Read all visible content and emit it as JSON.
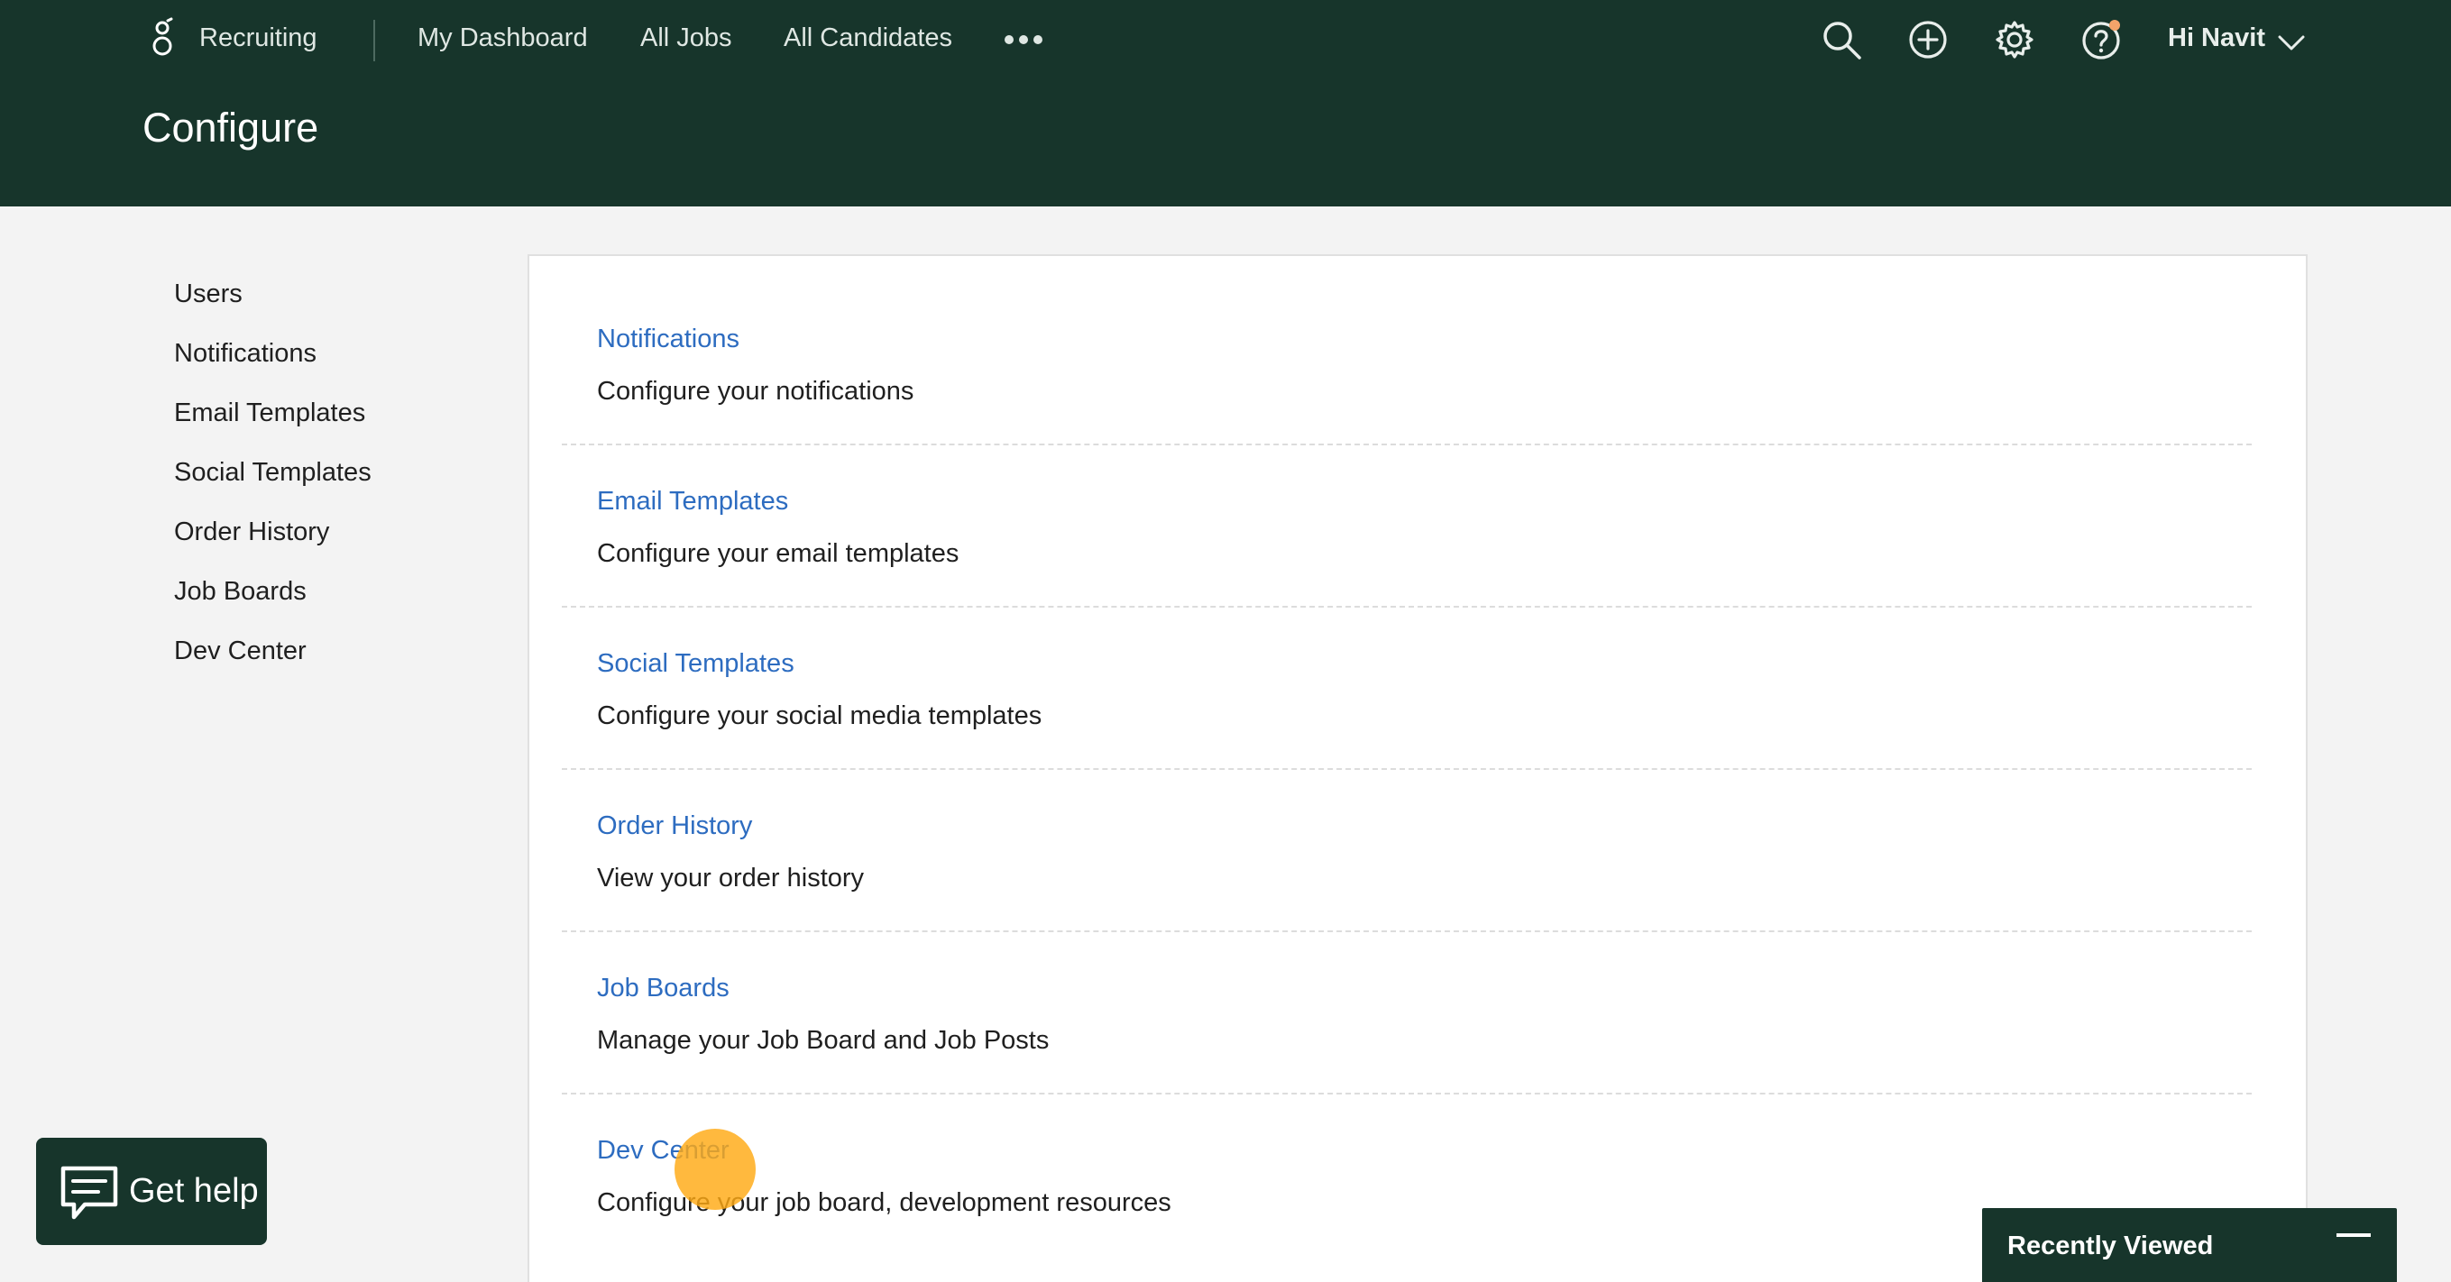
{
  "header": {
    "app_name": "Recruiting",
    "nav": [
      "My Dashboard",
      "All Jobs",
      "All Candidates"
    ],
    "greeting": "Hi Navit",
    "page_title": "Configure",
    "brand_color": "#17352b",
    "notification_dot_color": "#f4a46a"
  },
  "sidebar": {
    "items": [
      "Users",
      "Notifications",
      "Email Templates",
      "Social Templates",
      "Order History",
      "Job Boards",
      "Dev Center"
    ]
  },
  "main": {
    "entries": [
      {
        "title": "Notifications",
        "description": "Configure your notifications"
      },
      {
        "title": "Email Templates",
        "description": "Configure your email templates"
      },
      {
        "title": "Social Templates",
        "description": "Configure your social media templates"
      },
      {
        "title": "Order History",
        "description": "View your order history"
      },
      {
        "title": "Job Boards",
        "description": "Manage your Job Board and Job Posts"
      },
      {
        "title": "Dev Center",
        "description": "Configure your job board, development resources"
      }
    ],
    "link_color": "#2d6cc0"
  },
  "help": {
    "label": "Get help"
  },
  "recently_viewed": {
    "label": "Recently Viewed"
  },
  "icons": [
    "greenhouse-logo-icon",
    "more-dots-icon",
    "search-icon",
    "add-circle-icon",
    "gear-icon",
    "help-circle-icon",
    "chevron-down-icon",
    "chat-icon",
    "minimize-icon"
  ]
}
